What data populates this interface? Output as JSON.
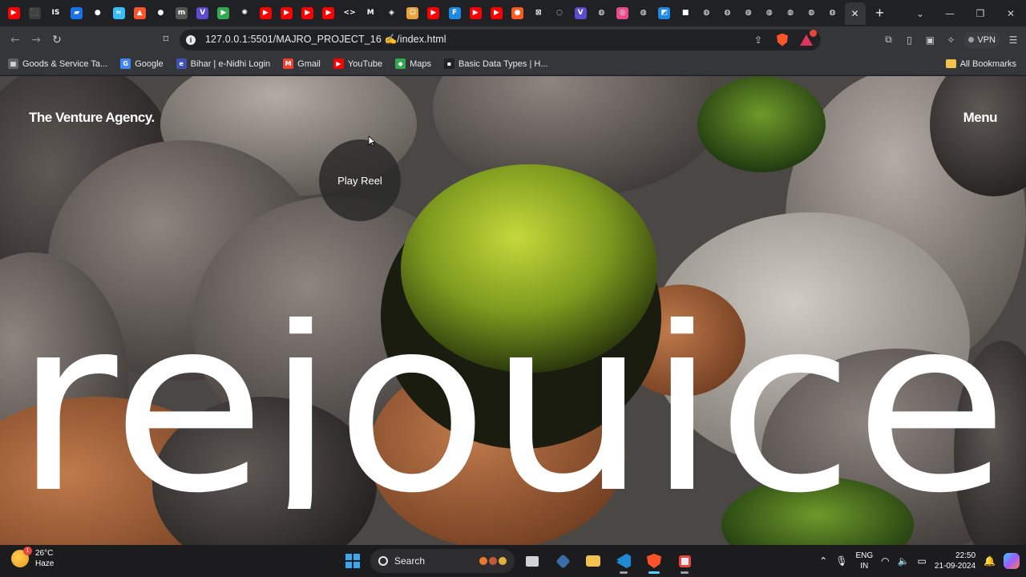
{
  "browser": {
    "tabs": [
      {
        "icon": "youtube-icon",
        "color": "#ff0000",
        "glyph": "▶"
      },
      {
        "icon": "puzzle-icon",
        "color": "#3c3c3c",
        "glyph": "⬛"
      },
      {
        "icon": "is-icon",
        "color": "#202124",
        "glyph": "IS"
      },
      {
        "icon": "docs-icon",
        "color": "#1a73e8",
        "glyph": "▰"
      },
      {
        "icon": "github-icon",
        "color": "#202124",
        "glyph": "●"
      },
      {
        "icon": "tailwind-icon",
        "color": "#38bdf8",
        "glyph": "≈"
      },
      {
        "icon": "brave-icon",
        "color": "#fb542b",
        "glyph": "▲"
      },
      {
        "icon": "github-icon",
        "color": "#202124",
        "glyph": "●"
      },
      {
        "icon": "mtt-icon",
        "color": "#555555",
        "glyph": "m"
      },
      {
        "icon": "v-icon",
        "color": "#5b4ccf",
        "glyph": "V"
      },
      {
        "icon": "play-store-icon",
        "color": "#34a853",
        "glyph": "▶"
      },
      {
        "icon": "chatgpt-icon",
        "color": "#202124",
        "glyph": "✺"
      },
      {
        "icon": "youtube-icon",
        "color": "#ff0000",
        "glyph": "▶"
      },
      {
        "icon": "youtube-icon",
        "color": "#ff0000",
        "glyph": "▶"
      },
      {
        "icon": "youtube-icon",
        "color": "#ff0000",
        "glyph": "▶"
      },
      {
        "icon": "youtube-icon",
        "color": "#ff0000",
        "glyph": "▶"
      },
      {
        "icon": "code-icon",
        "color": "#202124",
        "glyph": "<>"
      },
      {
        "icon": "medium-icon",
        "color": "#202124",
        "glyph": "M"
      },
      {
        "icon": "codepen-icon",
        "color": "#202124",
        "glyph": "◈"
      },
      {
        "icon": "freecodecamp-icon",
        "color": "#e8a33c",
        "glyph": "☺"
      },
      {
        "icon": "youtube-icon",
        "color": "#ff0000",
        "glyph": "▶"
      },
      {
        "icon": "figma-icon",
        "color": "#1e88e5",
        "glyph": "F"
      },
      {
        "icon": "youtube-icon",
        "color": "#ff0000",
        "glyph": "▶"
      },
      {
        "icon": "youtube-icon",
        "color": "#ff0000",
        "glyph": "▶"
      },
      {
        "icon": "circle-icon",
        "color": "#ff5722",
        "glyph": "●"
      },
      {
        "icon": "x-icon",
        "color": "#202124",
        "glyph": "⊠"
      },
      {
        "icon": "react-icon",
        "color": "#202124",
        "glyph": "◌"
      },
      {
        "icon": "v-icon",
        "color": "#5b4ccf",
        "glyph": "V"
      },
      {
        "icon": "globe-icon",
        "color": "#202124",
        "glyph": "◍"
      },
      {
        "icon": "dribbble-icon",
        "color": "#ea4c89",
        "glyph": "◎"
      },
      {
        "icon": "globe-icon",
        "color": "#202124",
        "glyph": "◍"
      },
      {
        "icon": "image-icon",
        "color": "#1e88e5",
        "glyph": "◩"
      },
      {
        "icon": "notion-icon",
        "color": "#202124",
        "glyph": "■"
      },
      {
        "icon": "globe-icon",
        "color": "#202124",
        "glyph": "◍"
      },
      {
        "icon": "globe-icon",
        "color": "#202124",
        "glyph": "◍"
      },
      {
        "icon": "globe-icon",
        "color": "#202124",
        "glyph": "◍"
      },
      {
        "icon": "globe-icon",
        "color": "#202124",
        "glyph": "◍"
      },
      {
        "icon": "globe-icon",
        "color": "#202124",
        "glyph": "◍"
      },
      {
        "icon": "globe-icon",
        "color": "#202124",
        "glyph": "◍"
      },
      {
        "icon": "globe-icon",
        "color": "#202124",
        "glyph": "◍"
      }
    ],
    "active_tab_glyph": "✕",
    "new_tab_glyph": "+",
    "url": "127.0.0.1:5501/MAJRO_PROJECT_16 ✍/index.html"
  },
  "bookmarks": [
    {
      "label": "Goods & Service Ta...",
      "icon": "gst-icon",
      "color": "#5f6368",
      "glyph": "▦"
    },
    {
      "label": "Google",
      "icon": "google-icon",
      "color": "#4285f4",
      "glyph": "G"
    },
    {
      "label": "Bihar | e-Nidhi Login",
      "icon": "enidhi-icon",
      "color": "#3f51b5",
      "glyph": "e"
    },
    {
      "label": "Gmail",
      "icon": "gmail-icon",
      "color": "#ea4335",
      "glyph": "M"
    },
    {
      "label": "YouTube",
      "icon": "youtube-icon",
      "color": "#ff0000",
      "glyph": "▶"
    },
    {
      "label": "Maps",
      "icon": "maps-icon",
      "color": "#34a853",
      "glyph": "◆"
    },
    {
      "label": "Basic Data Types | H...",
      "icon": "hackerrank-icon",
      "color": "#202124",
      "glyph": "▪"
    }
  ],
  "all_bookmarks": "All Bookmarks",
  "vpn_label": "VPN",
  "page": {
    "logo": "The Venture Agency.",
    "menu": "Menu",
    "play_reel": "Play Reel",
    "hero": "rejouice"
  },
  "taskbar": {
    "weather_temp": "26°C",
    "weather_desc": "Haze",
    "weather_badge": "1",
    "search": "Search",
    "lang_top": "ENG",
    "lang_bottom": "IN",
    "time": "22:50",
    "date": "21-09-2024"
  }
}
